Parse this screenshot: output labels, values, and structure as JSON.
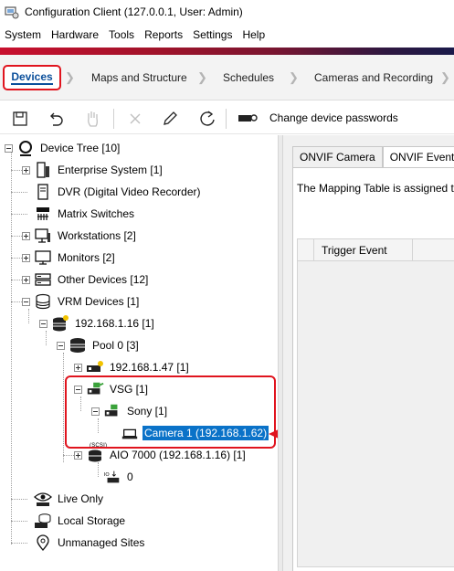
{
  "window": {
    "title": "Configuration Client (127.0.0.1, User: Admin)"
  },
  "menu": [
    "System",
    "Hardware",
    "Tools",
    "Reports",
    "Settings",
    "Help"
  ],
  "tabs": [
    {
      "label": "Devices",
      "active": true
    },
    {
      "label": "Maps and Structure"
    },
    {
      "label": "Schedules"
    },
    {
      "label": "Cameras and Recording"
    }
  ],
  "toolbar": {
    "icons": [
      "save-icon",
      "undo-icon",
      "hand-icon",
      "delete-icon",
      "edit-icon",
      "refresh-icon",
      "device-password-icon"
    ],
    "change_passwords_label": "Change device passwords"
  },
  "tree": {
    "root": "Device Tree [10]",
    "enterprise_system": "Enterprise System [1]",
    "dvr": "DVR (Digital Video Recorder)",
    "matrix_switches": "Matrix Switches",
    "workstations": "Workstations [2]",
    "monitors": "Monitors [2]",
    "other_devices": "Other Devices [12]",
    "vrm_devices": "VRM Devices [1]",
    "vrm_server": "192.168.1.16 [1]",
    "pool": "Pool 0 [3]",
    "encoder": "192.168.1.47 [1]",
    "vsg": "VSG [1]",
    "sony": "Sony [1]",
    "camera": "Camera 1 (192.168.1.62)",
    "aio": "AIO 7000 (192.168.1.16) [1]",
    "aio_badge": "(SCSI)",
    "io_item": "0",
    "live_only": "Live Only",
    "local_storage": "Local Storage",
    "unmanaged_sites": "Unmanaged Sites"
  },
  "right": {
    "tabs": [
      "ONVIF Camera",
      "ONVIF Event S"
    ],
    "text": "The Mapping Table is assigned to",
    "column": "Trigger Event"
  },
  "colors": {
    "accent_red": "#e0141e",
    "selection_blue": "#0a72c8",
    "tab_blue": "#0b4f9b"
  }
}
